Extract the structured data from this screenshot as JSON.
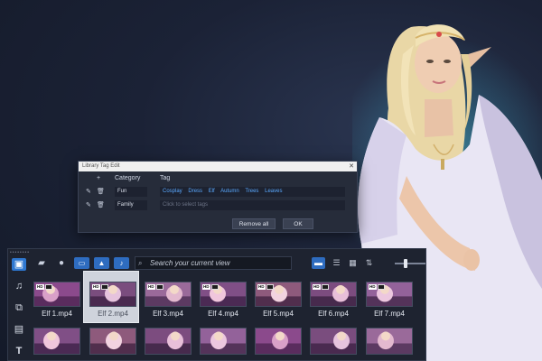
{
  "dialog": {
    "title": "Library Tag Edit",
    "close_glyph": "✕",
    "add_glyph": "+",
    "col_category": "Category",
    "col_tag": "Tag",
    "rows": [
      {
        "category": "Fun",
        "tags": [
          "Cosplay",
          "Dress",
          "Elf",
          "Autumn",
          "Trees",
          "Leaves"
        ]
      },
      {
        "category": "Family",
        "placeholder": "Click to select tags"
      }
    ],
    "remove_all": "Remove all",
    "ok": "OK"
  },
  "panel": {
    "grip": "••••••••",
    "search_placeholder": "Search your current view",
    "zoom_level": 0.3
  },
  "clips": [
    {
      "label": "Elf 1.mp4",
      "badge": "HD"
    },
    {
      "label": "Elf 2.mp4",
      "badge": "HD",
      "selected": true
    },
    {
      "label": "Elf 3.mp4",
      "badge": "HD"
    },
    {
      "label": "Elf 4.mp4",
      "badge": "HD"
    },
    {
      "label": "Elf 5.mp4",
      "badge": "HD"
    },
    {
      "label": "Elf 6.mp4",
      "badge": "HD"
    },
    {
      "label": "Elf 7.mp4",
      "badge": "HD"
    }
  ],
  "icons": {
    "media": "media-library-icon",
    "music": "music-icon",
    "transition": "transition-icon",
    "title": "title-icon",
    "text": "text-icon",
    "folder": "folder-open-icon",
    "disc": "disc-icon",
    "video_filter": "video-filter-icon",
    "photo_filter": "photo-filter-icon",
    "audio_filter": "audio-filter-icon",
    "search": "search-icon",
    "thumbnail_view": "thumbnail-view-icon",
    "list_view": "list-view-icon",
    "grid_view": "grid-view-icon",
    "sort": "sort-icon"
  },
  "colors": {
    "accent": "#2e6cc0",
    "tag_link": "#5aa9ff",
    "background": "#1b2236"
  }
}
